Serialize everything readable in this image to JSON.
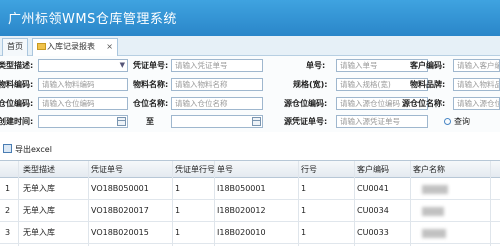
{
  "app": {
    "title": "广州标领WMS仓库管理系统"
  },
  "tabs": [
    {
      "label": "首页"
    },
    {
      "label": "入库记录报表",
      "close": "×"
    }
  ],
  "form": {
    "type_label": "类型描述:",
    "voucher_label": "凭证单号:",
    "voucher_ph": "请输入凭证单号",
    "docno_label": "单号:",
    "docno_ph": "请输入单号",
    "custcode_label": "客户编码:",
    "custcode_ph": "请输入客户编码",
    "matcode_label": "物料编码:",
    "matcode_ph": "请输入物料编码",
    "matname_label": "物料名称:",
    "matname_ph": "请输入物料名称",
    "spec_label": "规格(宽):",
    "spec_ph": "请输入规格(宽)",
    "brand_label": "物料品牌:",
    "brand_ph": "请输入物料品牌",
    "loccode_label": "仓位编码:",
    "loccode_ph": "请输入仓位编码",
    "locname_label": "仓位名称:",
    "locname_ph": "请输入仓位名称",
    "srcloccode_label": "源仓位编码:",
    "srcloccode_ph": "请输入源仓位编码",
    "srclocname_label": "源仓位名称:",
    "srclocname_ph": "请输入源仓位名称",
    "time_label": "创建时间:",
    "to_label": "至",
    "srcvoucher_label": "源凭证单号:",
    "srcvoucher_ph": "请输入源凭证单号",
    "query_label": "查询"
  },
  "toolbar": {
    "export_label": "导出excel"
  },
  "table": {
    "headers": [
      "类型描述",
      "凭证单号",
      "凭证单行号",
      "单号",
      "行号",
      "客户编码",
      "客户名称"
    ],
    "rows": [
      {
        "n": "1",
        "type": "无单入库",
        "voucher": "VO18B050001",
        "vline": "1",
        "docno": "I18B050001",
        "line": "1",
        "cust": "CU0041"
      },
      {
        "n": "2",
        "type": "无单入库",
        "voucher": "VO18B020017",
        "vline": "1",
        "docno": "I18B020012",
        "line": "1",
        "cust": "CU0034"
      },
      {
        "n": "3",
        "type": "无单入库",
        "voucher": "VO18B020015",
        "vline": "1",
        "docno": "I18B020010",
        "line": "1",
        "cust": "CU0033"
      }
    ]
  }
}
